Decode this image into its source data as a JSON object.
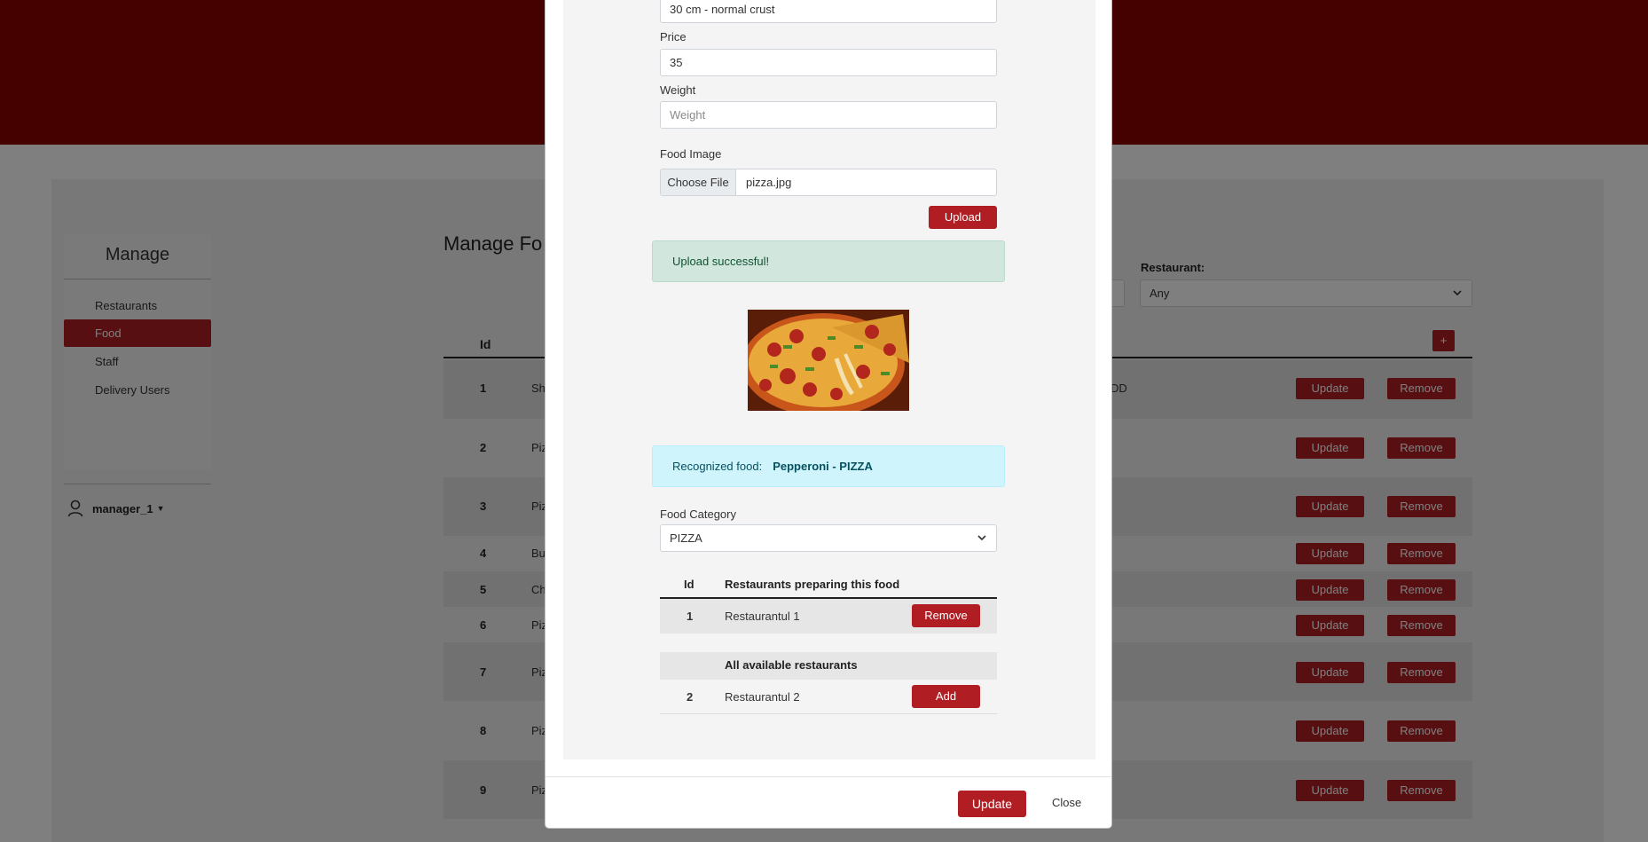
{
  "sidebar": {
    "title": "Manage",
    "items": [
      {
        "label": "Restaurants"
      },
      {
        "label": "Food"
      },
      {
        "label": "Staff"
      },
      {
        "label": "Delivery Users"
      }
    ],
    "user": "manager_1"
  },
  "main": {
    "heading": "Manage Fo",
    "restaurant_filter_label": "Restaurant:",
    "restaurant_filter_value": "Any",
    "add_label": "+",
    "id_header": "Id",
    "rows": [
      {
        "id": "1",
        "name": "Sh",
        "extra": "DD"
      },
      {
        "id": "2",
        "name": "Piz",
        "extra": ""
      },
      {
        "id": "3",
        "name": "Piz",
        "extra": ""
      },
      {
        "id": "4",
        "name": "Bu",
        "extra": ""
      },
      {
        "id": "5",
        "name": "Ch",
        "extra": ""
      },
      {
        "id": "6",
        "name": "Piz",
        "extra": ""
      },
      {
        "id": "7",
        "name": "Piz",
        "extra": ""
      },
      {
        "id": "8",
        "name": "Piz",
        "extra": ""
      },
      {
        "id": "9",
        "name": "Piz",
        "extra": ""
      }
    ],
    "update_label": "Update",
    "remove_label": "Remove"
  },
  "modal": {
    "description_value": "30 cm - normal crust",
    "price_label": "Price",
    "price_value": "35",
    "weight_label": "Weight",
    "weight_placeholder": "Weight",
    "image_label": "Food Image",
    "choose_file_label": "Choose File",
    "file_name": "pizza.jpg",
    "upload_label": "Upload",
    "upload_success": "Upload successful!",
    "recognized_label": "Recognized food:",
    "recognized_value": "Pepperoni - PIZZA",
    "category_label": "Food Category",
    "category_value": "PIZZA",
    "table": {
      "id_header": "Id",
      "preparing_header": "Restaurants preparing this food",
      "preparing": [
        {
          "id": "1",
          "name": "Restaurantul 1",
          "action": "Remove"
        }
      ],
      "available_header": "All available restaurants",
      "available": [
        {
          "id": "2",
          "name": "Restaurantul 2",
          "action": "Add"
        }
      ]
    },
    "update_label": "Update",
    "close_label": "Close"
  },
  "colors": {
    "brand": "#8b0000",
    "button": "#b01e23",
    "success_bg": "#d1e7dd",
    "info_bg": "#cff4fc"
  }
}
